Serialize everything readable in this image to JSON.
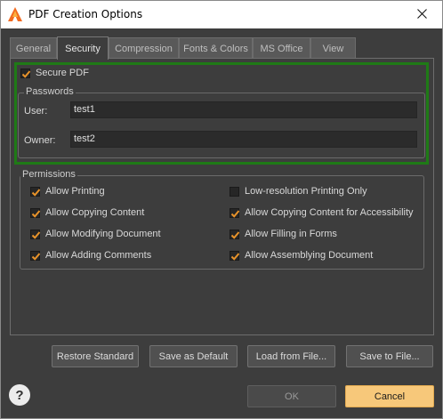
{
  "window": {
    "title": "PDF Creation Options"
  },
  "tabs": [
    {
      "label": "General"
    },
    {
      "label": "Security"
    },
    {
      "label": "Compression"
    },
    {
      "label": "Fonts & Colors"
    },
    {
      "label": "MS Office"
    },
    {
      "label": "View"
    }
  ],
  "active_tab": "Security",
  "secure_pdf": {
    "label": "Secure PDF",
    "checked": true
  },
  "passwords": {
    "title": "Passwords",
    "user_label": "User:",
    "user_value": "test1",
    "owner_label": "Owner:",
    "owner_value": "test2"
  },
  "permissions": {
    "title": "Permissions",
    "items": [
      {
        "label": "Allow Printing",
        "checked": true
      },
      {
        "label": "Low-resolution Printing Only",
        "checked": false
      },
      {
        "label": "Allow Copying Content",
        "checked": true
      },
      {
        "label": "Allow Copying Content for Accessibility",
        "checked": true
      },
      {
        "label": "Allow Modifying Document",
        "checked": true
      },
      {
        "label": "Allow Filling in Forms",
        "checked": true
      },
      {
        "label": "Allow Adding Comments",
        "checked": true
      },
      {
        "label": "Allow Assemblying Document",
        "checked": true
      }
    ]
  },
  "buttons": {
    "restore": "Restore Standard",
    "save_default": "Save as Default",
    "load": "Load from File...",
    "save_file": "Save to File...",
    "ok": "OK",
    "cancel": "Cancel",
    "help": "?"
  },
  "colors": {
    "highlight_border": "#1f7a16",
    "check_orange": "#e8932a",
    "cancel_bg": "#f7c87a",
    "app_icon": "#f26b21"
  },
  "icons": {
    "app": "pdf-app-icon",
    "close": "close-icon",
    "check": "checkmark-icon",
    "help": "help-icon"
  }
}
